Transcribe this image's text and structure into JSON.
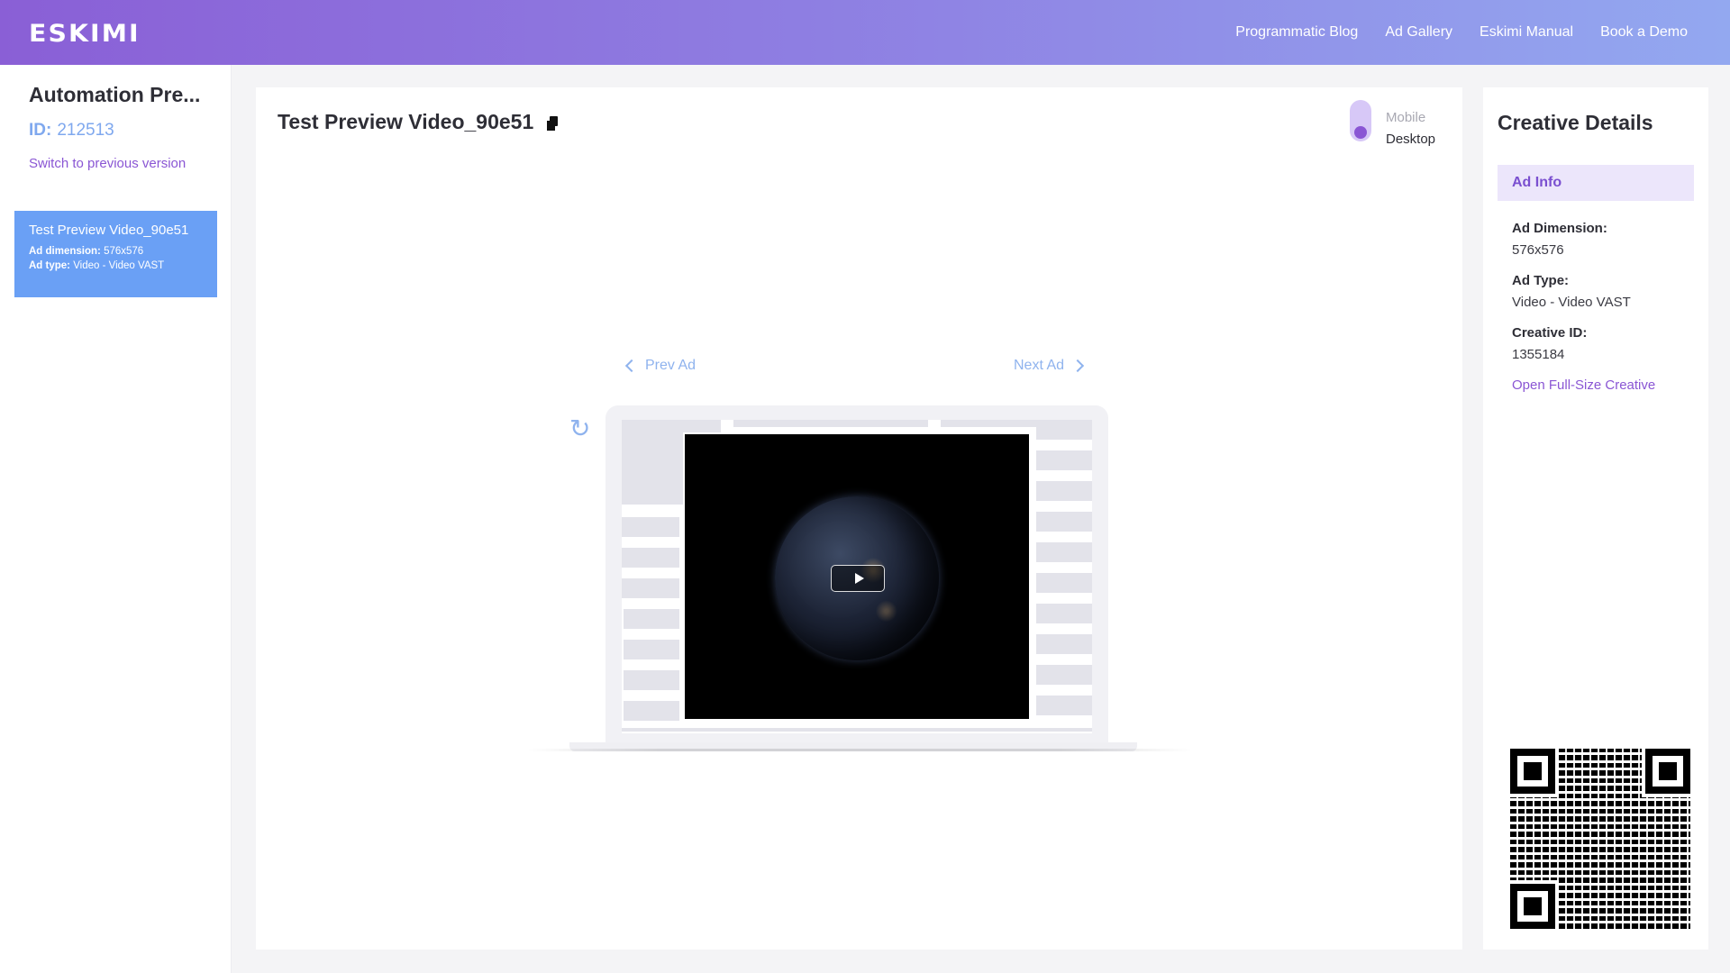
{
  "header": {
    "logo_text": "ESKIMI",
    "nav": [
      "Programmatic Blog",
      "Ad Gallery",
      "Eskimi Manual",
      "Book a Demo"
    ]
  },
  "sidebar": {
    "title": "Automation Pre...",
    "id_label": "ID:",
    "id_value": "212513",
    "switch_link": "Switch to previous version",
    "creative": {
      "name": "Test Preview Video_90e51",
      "dimension_label": "Ad dimension:",
      "dimension_value": "576x576",
      "type_label": "Ad type:",
      "type_value": "Video - Video VAST"
    }
  },
  "main": {
    "title": "Test Preview Video_90e51",
    "toggle": {
      "option_off": "Mobile",
      "option_on": "Desktop",
      "selected": "Desktop"
    },
    "prev_label": "Prev Ad",
    "next_label": "Next Ad"
  },
  "details": {
    "title": "Creative Details",
    "tab": "Ad Info",
    "fields": [
      {
        "label": "Ad Dimension:",
        "value": "576x576"
      },
      {
        "label": "Ad Type:",
        "value": "Video - Video VAST"
      },
      {
        "label": "Creative ID:",
        "value": "1355184"
      }
    ],
    "open_link": "Open Full-Size Creative"
  },
  "colors": {
    "accent": "#8a56d4",
    "link_blue": "#8fb3ee",
    "card_blue": "#6aa0f5"
  }
}
